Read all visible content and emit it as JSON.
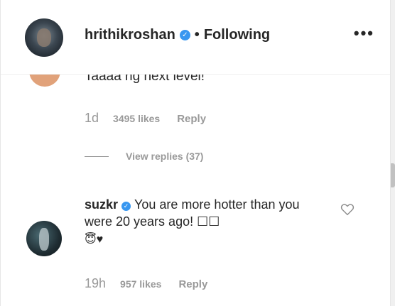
{
  "header": {
    "username": "hrithikroshan",
    "separator": "•",
    "follow_label": "Following",
    "more_label": "•••"
  },
  "comments": [
    {
      "text_partial": "Taaaa  ng  next level!",
      "age": "1d",
      "likes": "3495 likes",
      "reply_label": "Reply",
      "view_replies": "View replies (37)"
    },
    {
      "username": "suzkr",
      "text": "You are more hotter than you were 20 years ago! ☐☐",
      "emoji": "😇♥",
      "age": "19h",
      "likes": "957 likes",
      "reply_label": "Reply"
    }
  ],
  "colors": {
    "verified": "#3897f0",
    "muted": "#999999",
    "text": "#262626"
  },
  "icons": [
    "verified-badge-icon",
    "more-options-icon",
    "heart-icon"
  ]
}
